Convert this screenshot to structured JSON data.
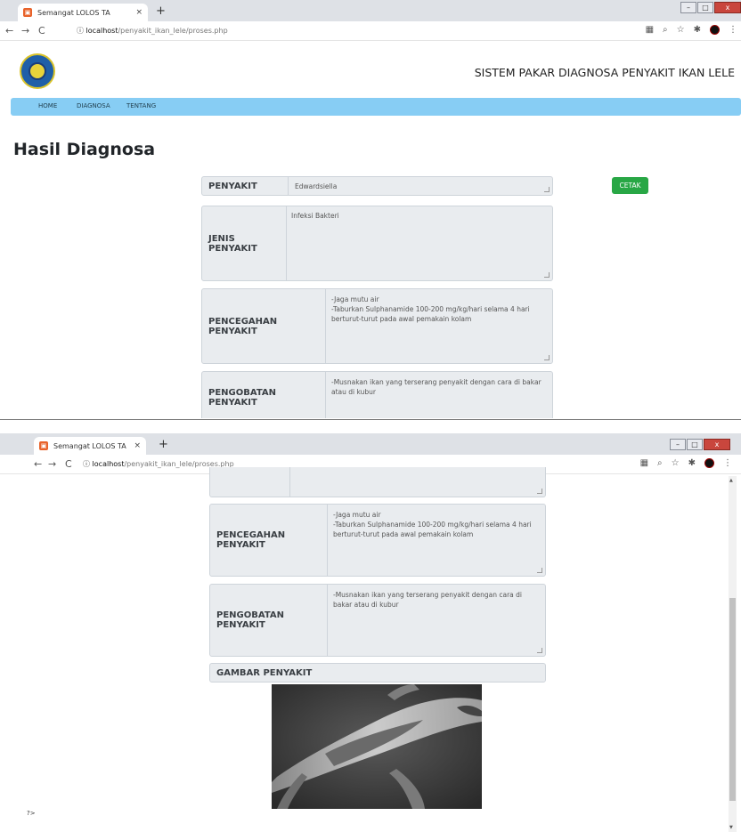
{
  "browser": {
    "tab_title": "Semangat LOLOS TA",
    "tab_close": "×",
    "new_tab": "+",
    "url_host": "localhost",
    "url_path": "/penyakit_ikan_lele/proses.php",
    "info_icon": "ⓘ"
  },
  "header": {
    "title": "SISTEM PAKAR DIAGNOSA PENYAKIT IKAN LELE"
  },
  "menu": {
    "items": [
      "HOME",
      "DIAGNOSA",
      "TENTANG"
    ]
  },
  "page": {
    "heading": "Hasil Diagnosa",
    "print_button": "CETAK",
    "footer_text": "?>"
  },
  "diagnosis": {
    "penyakit": {
      "label": "PENYAKIT",
      "value": "Edwardsiella"
    },
    "jenis": {
      "label": "JENIS PENYAKIT",
      "value": "Infeksi Bakteri"
    },
    "pencegahan": {
      "label": "PENCEGAHAN PENYAKIT",
      "value": "-Jaga mutu air\n-Taburkan Sulphanamide 100-200 mg/kg/hari selama 4 hari berturut-turut pada awal pemakain kolam"
    },
    "pengobatan": {
      "label": "PENGOBATAN PENYAKIT",
      "value": "-Musnakan ikan yang terserang penyakit dengan cara di bakar atau di kubur"
    },
    "gambar": {
      "label": "GAMBAR PENYAKIT"
    }
  }
}
